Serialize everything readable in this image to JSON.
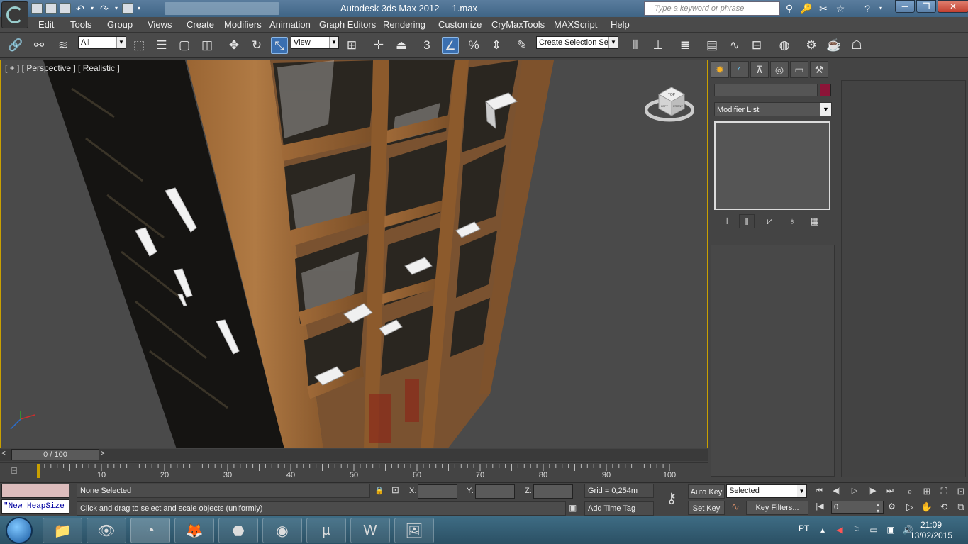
{
  "window": {
    "app_title": "Autodesk 3ds Max  2012",
    "file_name": "1.max",
    "search_placeholder": "Type a keyword or phrase",
    "minimize": "─",
    "restore": "❐",
    "close": "✕"
  },
  "menu": [
    "Edit",
    "Tools",
    "Group",
    "Views",
    "Create",
    "Modifiers",
    "Animation",
    "Graph Editors",
    "Rendering",
    "Customize",
    "CryMaxTools",
    "MAXScript",
    "Help"
  ],
  "toolbar": {
    "selection_filter": "All",
    "reference_coord": "View",
    "named_selection": "Create Selection Se",
    "snap_label": "3"
  },
  "viewport": {
    "label": "[ + ] [ Perspective ] [ Realistic ]",
    "viewcube_top": "TOP",
    "viewcube_front": "FRONT",
    "viewcube_left": "LEFT"
  },
  "command_panel": {
    "modifier_list": "Modifier List",
    "object_color": "#8c1438"
  },
  "timeline": {
    "frame_display": "0 / 100",
    "prev": "<",
    "next": ">",
    "ruler_labels": [
      "10",
      "20",
      "30",
      "40",
      "50",
      "60",
      "70",
      "80",
      "90",
      "100"
    ]
  },
  "status": {
    "maxscript_output": "\"New HeapSize",
    "selection": "None Selected",
    "prompt": "Click and drag to select and scale objects (uniformly)",
    "x_label": "X:",
    "y_label": "Y:",
    "z_label": "Z:",
    "grid": "Grid = 0,254m",
    "add_time_tag": "Add Time Tag",
    "auto_key": "Auto Key",
    "set_key": "Set Key",
    "key_mode": "Selected",
    "key_filters": "Key Filters...",
    "current_frame": "0"
  },
  "taskbar": {
    "language": "PT",
    "time": "21:09",
    "date": "13/02/2015"
  }
}
